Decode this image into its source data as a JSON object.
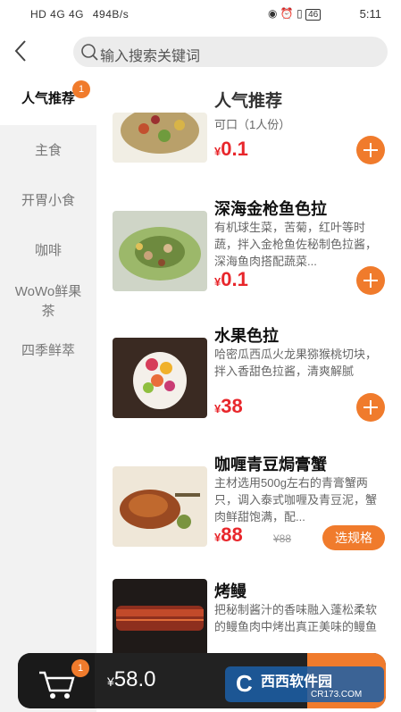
{
  "status_bar": {
    "network": "HD 4G 4G",
    "speed": "494B/s",
    "battery": "46",
    "time": "5:11"
  },
  "search": {
    "placeholder": "输入搜索关键词"
  },
  "sidebar": {
    "items": [
      {
        "label": "人气推荐",
        "badge": "1"
      },
      {
        "label": "主食"
      },
      {
        "label": "开胃小食"
      },
      {
        "label": "咖啡"
      },
      {
        "label": "WoWo鲜果茶"
      },
      {
        "label": "四季鲜萃"
      }
    ]
  },
  "section_title": "人气推荐",
  "products": [
    {
      "name": "",
      "desc": "可口（1人份）",
      "currency": "¥",
      "price": "0.1"
    },
    {
      "name": "深海金枪鱼色拉",
      "desc": "有机球生菜，苦菊，红叶等时蔬，拌入金枪鱼佐秘制色拉酱，深海鱼肉搭配蔬菜...",
      "currency": "¥",
      "price": "0.1"
    },
    {
      "name": "水果色拉",
      "desc": "哈密瓜西瓜火龙果猕猴桃切块，拌入香甜色拉酱，清爽解腻",
      "currency": "¥",
      "price": "38"
    },
    {
      "name": "咖喱青豆焗膏蟹",
      "desc": "主材选用500g左右的青膏蟹两只，调入泰式咖喱及青豆泥，蟹肉鲜甜饱满，配...",
      "currency": "¥",
      "price": "88",
      "old_price": "¥88",
      "button": "选规格"
    },
    {
      "name": "烤鳗",
      "desc": "把秘制酱汁的香味融入蓬松柔软的鳗鱼肉中烤出真正美味的鳗鱼"
    }
  ],
  "cart": {
    "badge": "1",
    "currency": "¥",
    "total": "58.0"
  },
  "watermark": {
    "text1": "西西软件园",
    "text2": "CR173.COM"
  },
  "colors": {
    "accent": "#f07b2c",
    "price": "#e8262b"
  }
}
